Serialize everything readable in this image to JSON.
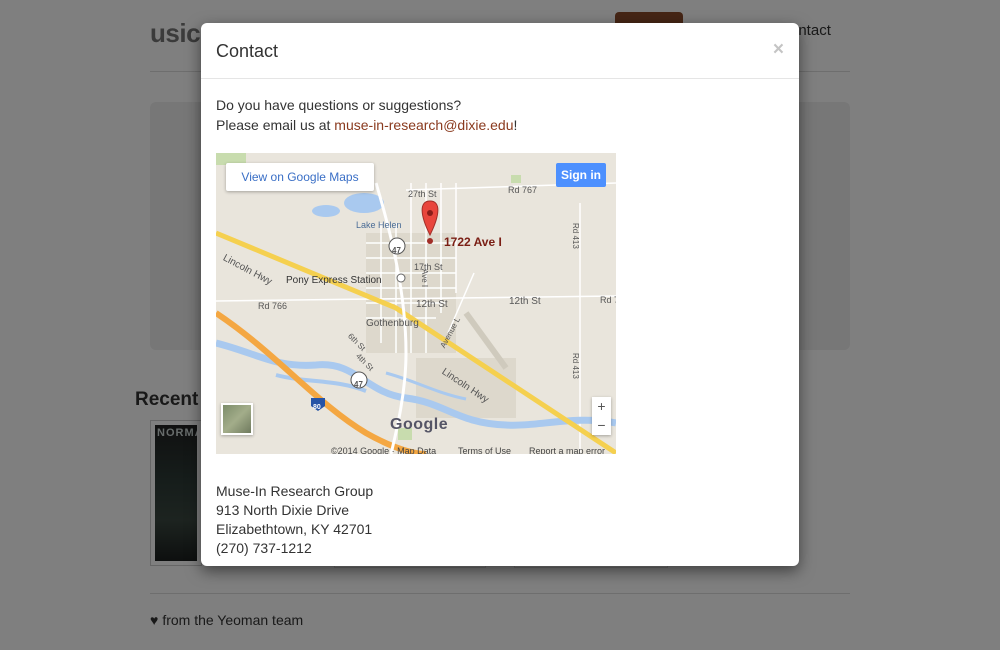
{
  "background": {
    "brand": "usic.",
    "nav_contact": "ontact",
    "recent_title": "Recent",
    "thumb_text": "NORMA",
    "footer_text": "from the Yeoman team"
  },
  "modal": {
    "title": "Contact",
    "close_label": "×",
    "intro_line1": "Do you have questions or suggestions?",
    "intro_prefix": "Please email us at ",
    "email": "muse-in-research@dixie.edu",
    "intro_suffix": "!",
    "address": {
      "org": "Muse-In Research Group",
      "street": "913 North Dixie Drive",
      "city": "Elizabethtown, KY 42701",
      "phone": "(270) 737-1212"
    }
  },
  "map": {
    "view_button": "View on Google Maps",
    "sign_in": "Sign in",
    "zoom_in": "+",
    "zoom_out": "−",
    "marker_label": "1722 Ave I",
    "labels": {
      "st27": "27th St",
      "rd767": "Rd 767",
      "lake": "Lake Helen",
      "hwy47a": "47",
      "lincoln_left": "Lincoln Hwy",
      "pony": "Pony Express Station",
      "st17": "17th St",
      "ave_i": "Ave I",
      "rd766": "Rd 766",
      "st12a": "12th St",
      "st12b": "12th St",
      "rd7": "Rd 7",
      "gothenburg": "Gothenburg",
      "avenue_l": "Avenue L",
      "st6": "6th St",
      "st4": "4th St",
      "hwy47b": "47",
      "lincoln_right": "Lincoln Hwy",
      "rd413a": "Rd 413",
      "rd413b": "Rd 413",
      "i80": "80",
      "google": "Google",
      "copyright": "©2014 Google · Map Data",
      "terms": "Terms of Use",
      "report": "Report a map error"
    }
  },
  "colors": {
    "link": "#8a3a1e",
    "brand_button": "#8a4a2a",
    "sign_in": "#4d90fe"
  }
}
